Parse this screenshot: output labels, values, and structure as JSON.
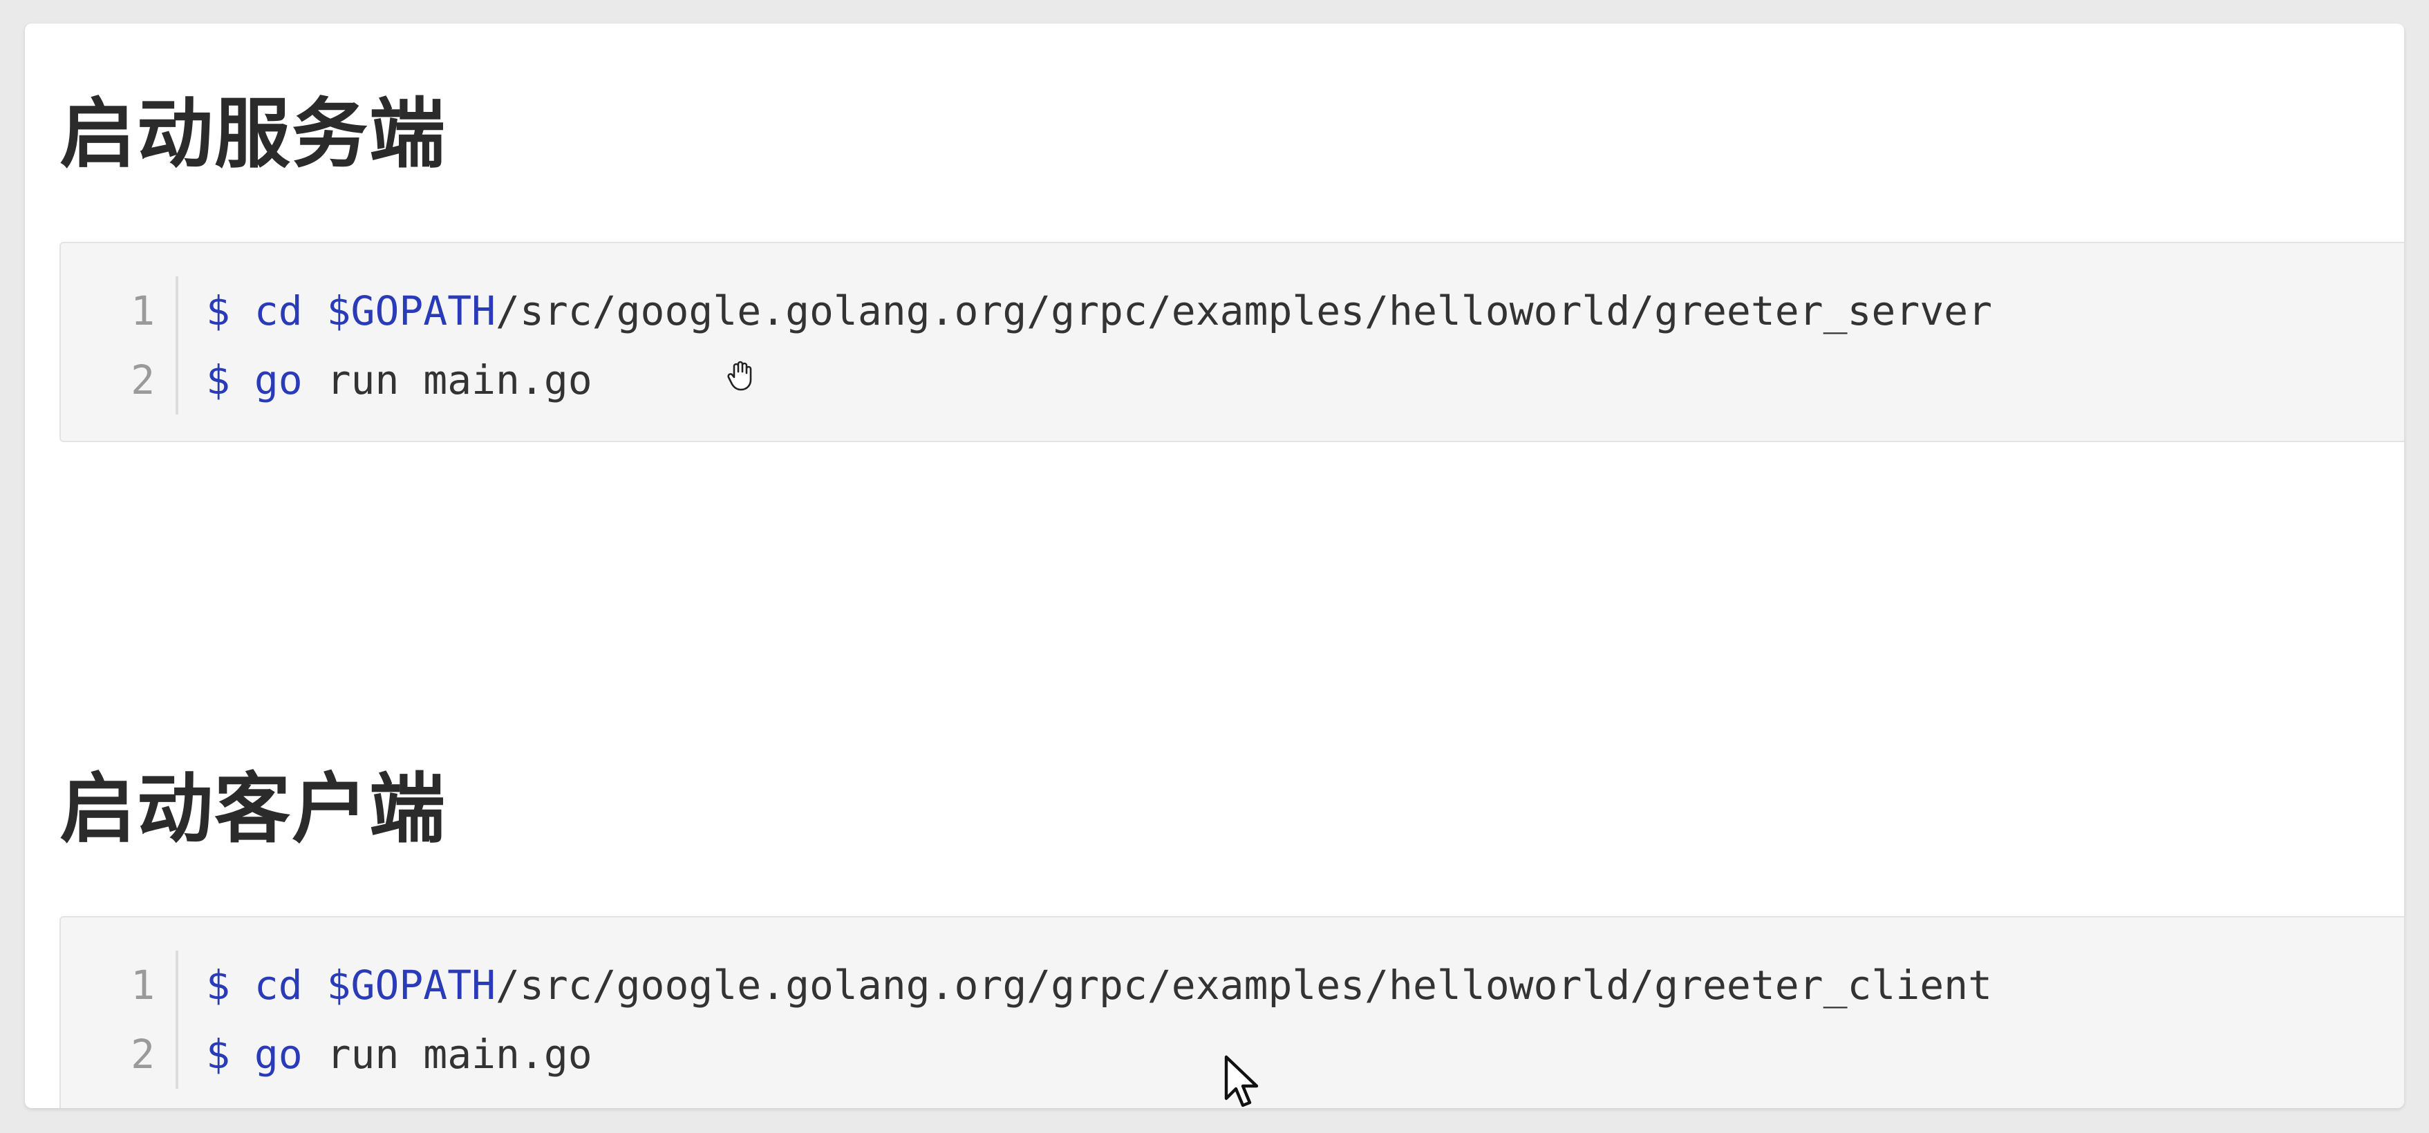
{
  "sections": [
    {
      "heading": "启动服务端",
      "lines": [
        {
          "num": "1",
          "prompt": "$",
          "cmd": "cd",
          "var": "$GOPATH",
          "rest": "/src/google.golang.org/grpc/examples/helloworld/greeter_server"
        },
        {
          "num": "2",
          "prompt": "$",
          "cmd": "go",
          "rest": " run main.go"
        }
      ]
    },
    {
      "heading": "启动客户端",
      "lines": [
        {
          "num": "1",
          "prompt": "$",
          "cmd": "cd",
          "var": "$GOPATH",
          "rest": "/src/google.golang.org/grpc/examples/helloworld/greeter_client"
        },
        {
          "num": "2",
          "prompt": "$",
          "cmd": "go",
          "rest": " run main.go"
        }
      ]
    }
  ],
  "colors": {
    "keyword": "#2a3bb8",
    "text": "#333333",
    "line_number": "#9a9a9a",
    "code_background": "#f5f5f5"
  },
  "icons": {
    "cursor_hand": "hand-cursor-icon",
    "cursor_arrow": "arrow-cursor-icon"
  }
}
